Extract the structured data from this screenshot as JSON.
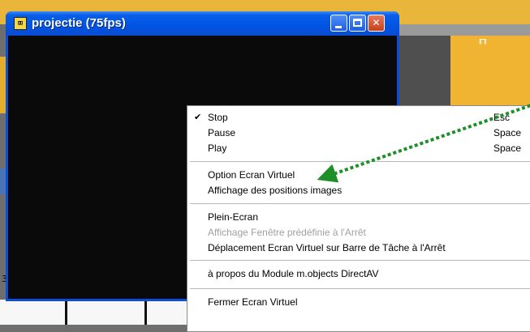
{
  "window": {
    "title": "projectie (75fps)",
    "icon": "app-icon",
    "icon_glyph": "⌧",
    "buttons": {
      "minimize": "minimize-icon",
      "maximize": "maximize-icon",
      "close_glyph": "✕"
    }
  },
  "background": {
    "marker_glyph": "╓╖",
    "partial_number": "3"
  },
  "menu": {
    "check_glyph": "✔",
    "items": [
      {
        "label": "Stop",
        "shortcut": "Esc",
        "checked": true
      },
      {
        "label": "Pause",
        "shortcut": "Space"
      },
      {
        "label": "Play",
        "shortcut": "Space"
      },
      {
        "label": "Option Ecran Virtuel"
      },
      {
        "label": "Affichage des positions images"
      },
      {
        "label": "Plein-Ecran"
      },
      {
        "label": "Affichage Fenêtre prédéfinie à l'Arrêt",
        "disabled": true
      },
      {
        "label": "Déplacement Ecran Virtuel sur Barre de Tâche à l'Arrêt"
      },
      {
        "label": "à propos du Module m.objects DirectAV"
      },
      {
        "label": "Fermer Ecran Virtuel"
      }
    ]
  },
  "colors": {
    "title_bar": "#0055e5",
    "close_button": "#c5411f",
    "arrow": "#1f8f2a",
    "disabled_text": "#a0a0a0"
  }
}
